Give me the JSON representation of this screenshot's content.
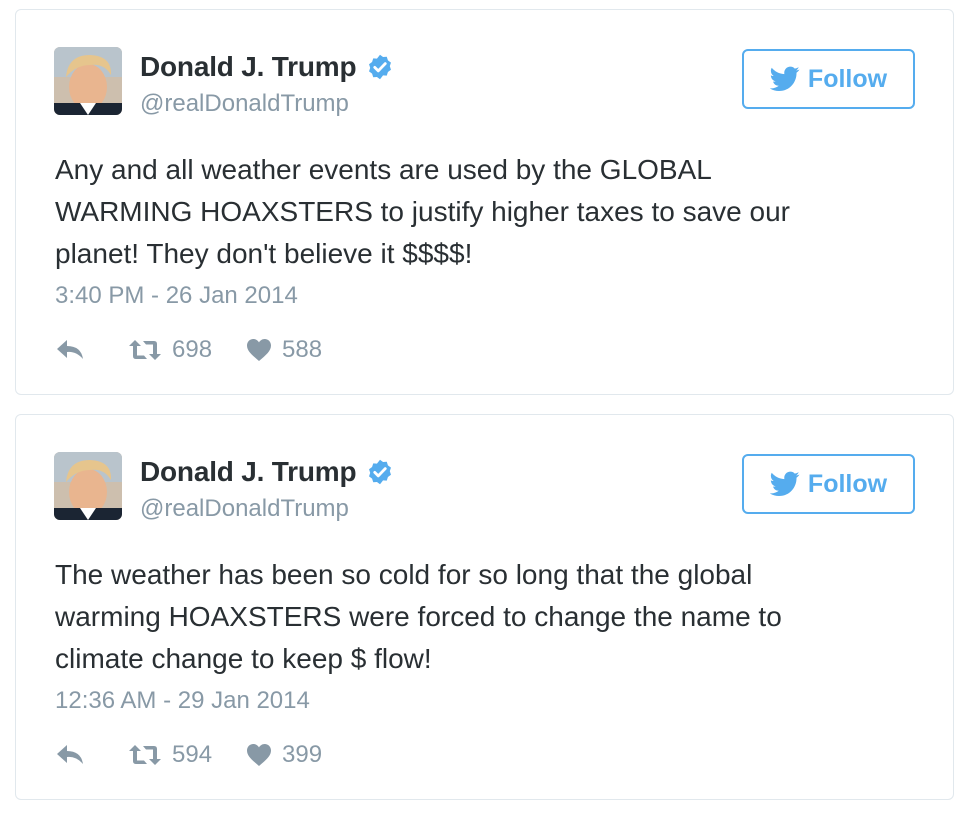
{
  "colors": {
    "accent": "#55acee",
    "verified": "#55acee",
    "text": "#292f33",
    "muted": "#8899a6",
    "border": "#e1e8ed",
    "action_icon": "#8899a6"
  },
  "icons": {
    "verified": "verified-badge-icon",
    "follow": "twitter-bird-icon",
    "reply": "reply-arrow-icon",
    "retweet": "retweet-icon",
    "like": "heart-icon"
  },
  "tweets": [
    {
      "author": {
        "name": "Donald J. Trump",
        "handle": "@realDonaldTrump"
      },
      "follow_label": "Follow",
      "text_lines": [
        "Any and all weather events are used by the GLOBAL",
        "WARMING HOAXSTERS to justify higher taxes to save our",
        "planet! They don't believe it $$$$!"
      ],
      "timestamp": "3:40 PM - 26 Jan 2014",
      "retweets": "698",
      "likes": "588"
    },
    {
      "author": {
        "name": "Donald J. Trump",
        "handle": "@realDonaldTrump"
      },
      "follow_label": "Follow",
      "text_lines": [
        "The weather has been so cold for so long that the global",
        "warming HOAXSTERS were forced to change the name to",
        "climate change to keep $ flow!"
      ],
      "timestamp": "12:36 AM - 29 Jan 2014",
      "retweets": "594",
      "likes": "399"
    }
  ]
}
